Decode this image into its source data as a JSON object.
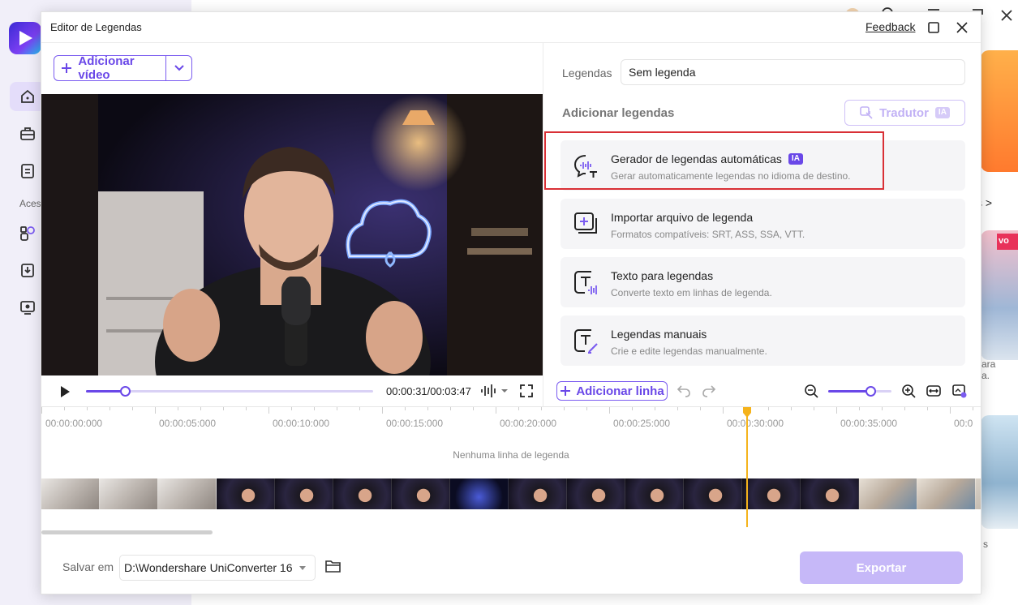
{
  "dialog": {
    "title": "Editor de Legendas",
    "feedback_label": "Feedback"
  },
  "background": {
    "sidebar_section_label": "Aces",
    "right_link_text": "s >",
    "right_text_1": "ara",
    "right_text_2": "a.",
    "right_text_3": "s",
    "promo_badge": "vo"
  },
  "left": {
    "add_video_label": "Adicionar vídeo",
    "player": {
      "timecode": "00:00:31/00:03:47",
      "progress_fraction": 0.135
    }
  },
  "right": {
    "legendas_label": "Legendas",
    "legendas_value": "Sem legenda",
    "adicionar_label": "Adicionar legendas",
    "tradutor_label": "Tradutor",
    "ia_badge": "IA",
    "options": [
      {
        "title": "Gerador de legendas automáticas",
        "badge": "IA",
        "desc": "Gerar automaticamente legendas no idioma de destino."
      },
      {
        "title": "Importar arquivo de legenda",
        "desc": "Formatos compatíveis: SRT, ASS, SSA, VTT."
      },
      {
        "title": "Texto para legendas",
        "desc": "Converte texto em linhas de legenda."
      },
      {
        "title": "Legendas manuais",
        "desc": "Crie e edite legendas manualmente."
      }
    ],
    "add_line_label": "Adicionar linha",
    "zoom_fraction": 0.67
  },
  "timeline": {
    "ticks": [
      "00:00:00:000",
      "00:00:05:000",
      "00:00:10:000",
      "00:00:15:000",
      "00:00:20:000",
      "00:00:25:000",
      "00:00:30:000",
      "00:00:35:000",
      "00:0"
    ],
    "empty_text": "Nenhuma linha de legenda"
  },
  "footer": {
    "save_label": "Salvar em",
    "path_value": "D:\\Wondershare UniConverter 16",
    "export_label": "Exportar"
  },
  "colors": {
    "accent": "#6a48e8",
    "highlight": "#d93036",
    "playhead": "#f5b31b",
    "export_disabled": "#c6b8f8"
  }
}
